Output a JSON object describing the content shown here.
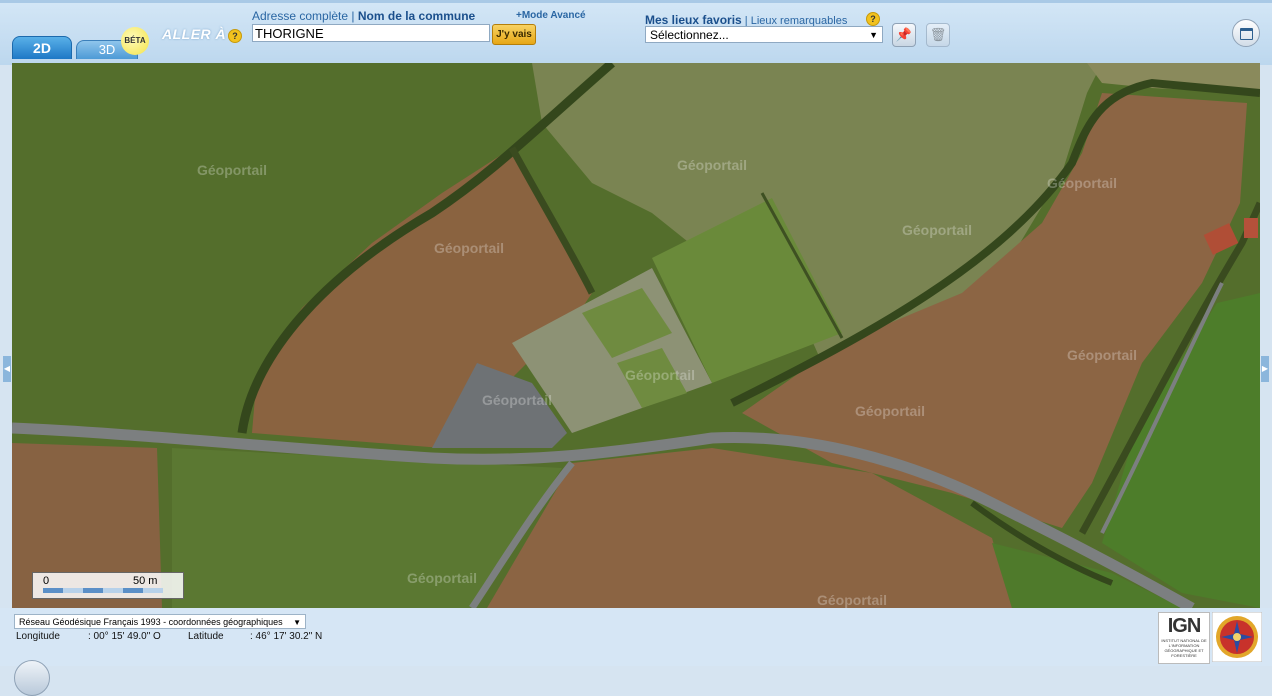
{
  "toolbar": {
    "tab_2d": "2D",
    "tab_3d": "3D",
    "beta_badge": "BÉTA",
    "goto_label": "ALLER À",
    "help_glyph": "?",
    "search_link_full": "Adresse complète",
    "search_link_separator": "|",
    "search_link_commune": "Nom de la commune",
    "advanced_mode": "+Mode Avancé",
    "search_value": "THORIGNE",
    "go_button": "J'y vais",
    "favorites_label": "Mes lieux favoris",
    "favorites_separator": "|",
    "remarkable_places": "Lieux remarquables",
    "favorites_select": "Sélectionnez...",
    "icons": [
      "pin-icon",
      "trash-icon",
      "window-icon"
    ]
  },
  "map": {
    "watermark": "Géoportail",
    "scale_zero": "0",
    "scale_distance": "50 m",
    "layer": "satellite imagery"
  },
  "bottombar": {
    "crs_select": "Réseau Géodésique Français 1993 - coordonnées géographiques",
    "longitude_label": "Longitude",
    "longitude_value": ": 00° 15' 49.0\" O",
    "latitude_label": "Latitude",
    "latitude_value": ": 46° 17' 30.2\" N",
    "ign_logo": "IGN",
    "ign_subtext": "INSTITUT NATIONAL DE L'INFORMATION GÉOGRAPHIQUE ET FORESTIÈRE"
  },
  "colors": {
    "toolbar_bg": "#c6def3",
    "accent_blue": "#1e78c6",
    "go_button": "#e7a716",
    "plowed_field": "#8a6440",
    "grass_field": "#5d7a33",
    "road": "#7c7f80"
  }
}
